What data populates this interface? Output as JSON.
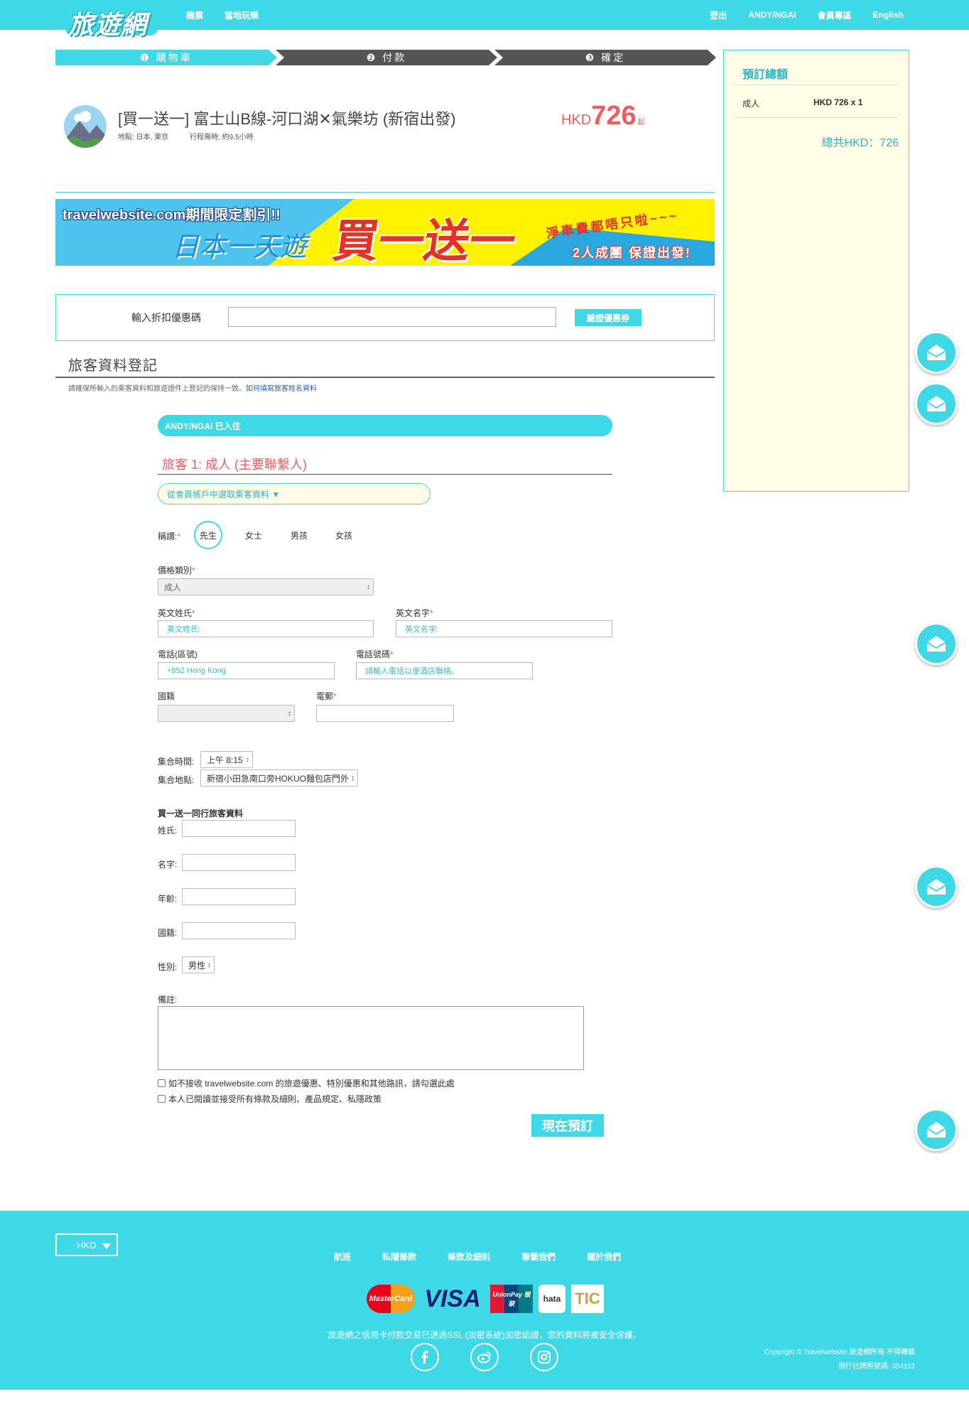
{
  "nav": {
    "logo": "旅遊網",
    "left": [
      "機票",
      "當地玩樂"
    ],
    "right": [
      "登出",
      "ANDY/NGAI",
      "會員專區",
      "English"
    ]
  },
  "steps": [
    "❶ 購物車",
    "❷ 付款",
    "❸ 確定"
  ],
  "product": {
    "title": "[買一送一] 富士山B線-河口湖✕氣樂坊 (新宿出發)",
    "location": "地點: 日本, 東京",
    "duration": "行程需時: 約9.5小時",
    "price_currency": "HKD",
    "price_value": "726",
    "price_suffix": "起"
  },
  "banner": {
    "tag": "travelwebsite.com期間限定割引!!",
    "main": "日本一天遊",
    "big": "買一送一",
    "sub1": "淨車費都唔只啦~~~",
    "sub2": "2人成團 保證出發!"
  },
  "coupon": {
    "label": "輸入折扣優惠碼",
    "button": "驗證優惠券"
  },
  "section": {
    "title": "旅客資料登記",
    "note": "請確保所輸入的乘客資料和旅遊證件上登記的保持一致。",
    "note_link": "如何填寫旅客姓名資料"
  },
  "form": {
    "logged_in": "ANDY/NGAI 已入住",
    "traveler_title": "旅客 1: 成人 (主要聯繫人)",
    "pick_member": "從會員帳戶中選取乘客資料 ▼",
    "salutation_label": "稱謂:",
    "salutations": [
      "先生",
      "女士",
      "男孩",
      "女孩"
    ],
    "price_type_label": "價格類別",
    "price_type_value": "成人",
    "last_name_label": "英文姓氏",
    "last_name_placeholder": "英文姓氏:",
    "first_name_label": "英文名字",
    "first_name_placeholder": "英文名字:",
    "area_code_label": "電話(區號)",
    "area_code_value": "+852 Hong Kong",
    "phone_label": "電話號碼",
    "phone_placeholder": "請輸入電話以便酒店聯絡。",
    "nationality_label": "國籍",
    "email_label": "電郵",
    "meet_time_label": "集合時間:",
    "meet_time_value": "上午 8:15",
    "meet_place_label": "集合地點:",
    "meet_place_value": "新宿小田急南口旁HOKUO麵包店門外",
    "companion_title": "買一送一同行旅客資料",
    "comp_last_label": "姓氏:",
    "comp_first_label": "名字:",
    "comp_age_label": "年齡:",
    "comp_nat_label": "國籍:",
    "comp_gender_label": "性別:",
    "comp_gender_value": "男性",
    "remarks_label": "備註:",
    "check1": "如不接收 travelwebsite.com 的旅遊優惠、特別優惠和其他路訊，請勾選此處",
    "check2": "本人已閱讀並接受所有條款及細則、產品規定、私隱政策",
    "book_button": "現在預訂"
  },
  "summary": {
    "title": "預訂總額",
    "row_label": "成人",
    "row_value": "HKD 726 x 1",
    "total": "總共HKD：726"
  },
  "footer": {
    "currency": "HKD",
    "links": [
      "航班",
      "私隱條款",
      "條款及細則",
      "聯繫我們",
      "關於我們"
    ],
    "pay_logos": [
      "MasterCard",
      "VISA",
      "UnionPay 银联",
      "hata",
      "TIC"
    ],
    "ssl_note": "旅遊網之信用卡付款交易已透過SSL (加密系統)加密認證，您的資料將被安全保護。",
    "copyright": "Copyright © Travelwebsite 旅遊網所有 不得轉載",
    "license": "旅行社牌照號碼: 354113"
  },
  "colors": {
    "accent": "#3fd8e6",
    "price": "#f25c5c",
    "summary_bg": "#fffde6"
  }
}
